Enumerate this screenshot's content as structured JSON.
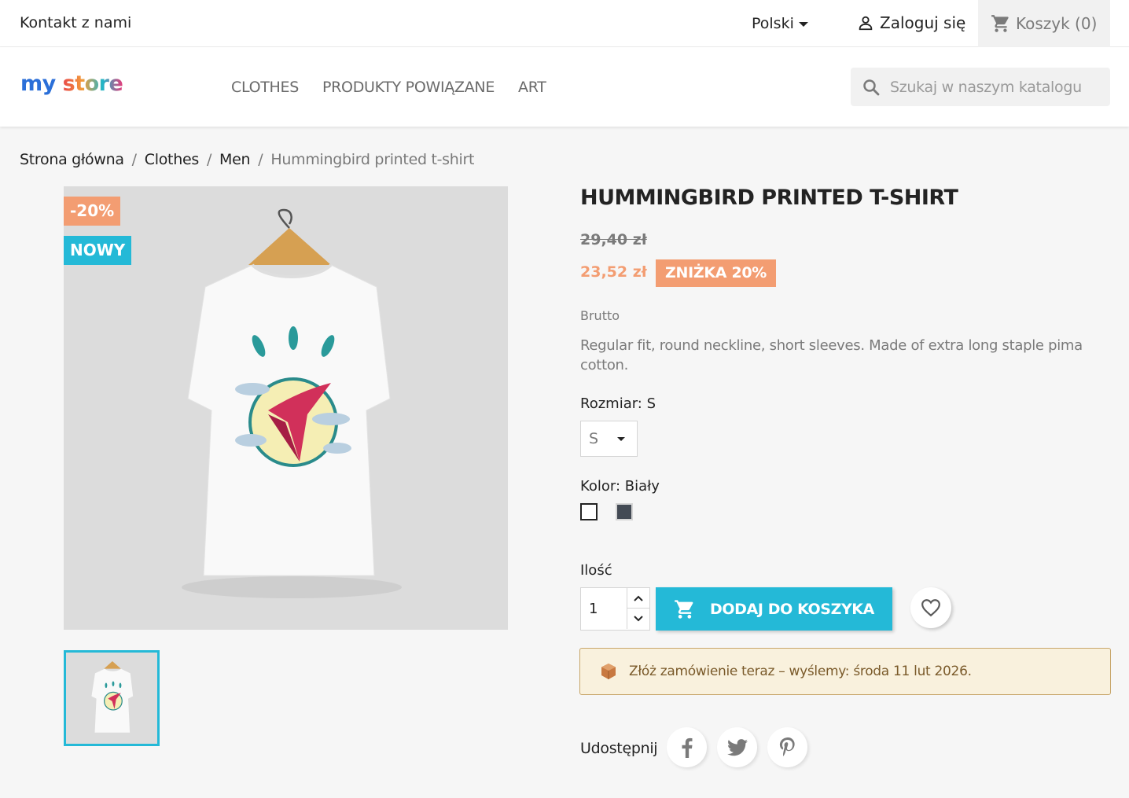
{
  "topbar": {
    "contact": "Kontakt z nami",
    "language": "Polski",
    "login": "Zaloguj się",
    "cart": "Koszyk (0)"
  },
  "header": {
    "logo": {
      "part1": "my",
      "part2": "store"
    },
    "menu": [
      "CLOTHES",
      "PRODUKTY POWIĄZANE",
      "ART"
    ],
    "search_placeholder": "Szukaj w naszym katalogu"
  },
  "breadcrumb": [
    "Strona główna",
    "Clothes",
    "Men",
    "Hummingbird printed t-shirt"
  ],
  "product": {
    "flags": {
      "discount": "-20%",
      "new": "NOWY"
    },
    "title": "HUMMINGBIRD PRINTED T-SHIRT",
    "regular_price": "29,40 zł",
    "price": "23,52 zł",
    "discount_badge": "ZNIŻKA 20%",
    "tax_label": "Brutto",
    "description": "Regular fit, round neckline, short sleeves. Made of extra long staple pima cotton.",
    "size_label": "Rozmiar: S",
    "size_value": "S",
    "color_label": "Kolor: Biały",
    "colors": [
      "#ffffff",
      "#434a54"
    ],
    "quantity_label": "Ilość",
    "quantity": "1",
    "add_to_cart": "DODAJ DO KOSZYKA",
    "delivery": "Złóż zamówienie teraz – wyślemy: środa 11 lut 2026.",
    "share_label": "Udostępnij"
  },
  "colors": {
    "accent": "#24b9d7",
    "discount": "#f39d72"
  }
}
